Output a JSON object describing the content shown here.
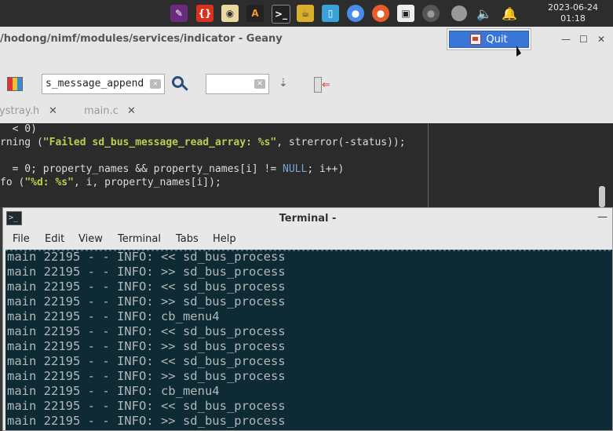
{
  "panel": {
    "clock_date": "2023-06-24",
    "clock_time": "01:18",
    "tray_icons": [
      "pen-icon",
      "brackets-icon",
      "disc-icon",
      "terminal-a-icon",
      "terminal-icon",
      "teapot-icon",
      "phone-icon",
      "chrome-icon",
      "firefox-icon",
      "film-icon",
      "circle-icon",
      "indicator-icon",
      "volume-icon",
      "bell-icon"
    ]
  },
  "quit_menu": {
    "label": "Quit"
  },
  "geany": {
    "title": "/hodong/nimf/modules/services/indicator - Geany",
    "search_value": "s_message_append",
    "tabs": [
      {
        "label": "ystray.h"
      },
      {
        "label": "main.c"
      }
    ],
    "code": {
      "line1a": "< 0)",
      "line2a": "rning (",
      "line2b": "\"Failed sd_bus_message_read_array: %s\"",
      "line2c": ", strerror(-status));",
      "line3a": "= 0; property_names && property_names[i] != ",
      "line3b": "NULL",
      "line3c": "; i++)",
      "line4a": "fo (",
      "line4b": "\"%d: %s\"",
      "line4c": ", i, property_names[i]);"
    }
  },
  "terminal": {
    "title": "Terminal -",
    "menu": [
      "File",
      "Edit",
      "View",
      "Terminal",
      "Tabs",
      "Help"
    ],
    "lines": [
      "main 22195 - - INFO: << sd_bus_process",
      "main 22195 - - INFO: >> sd_bus_process",
      "main 22195 - - INFO: << sd_bus_process",
      "main 22195 - - INFO: >> sd_bus_process",
      "main 22195 - - INFO: cb_menu4",
      "main 22195 - - INFO: << sd_bus_process",
      "main 22195 - - INFO: >> sd_bus_process",
      "main 22195 - - INFO: << sd_bus_process",
      "main 22195 - - INFO: >> sd_bus_process",
      "main 22195 - - INFO: cb_menu4",
      "main 22195 - - INFO: << sd_bus_process",
      "main 22195 - - INFO: >> sd_bus_process"
    ]
  }
}
